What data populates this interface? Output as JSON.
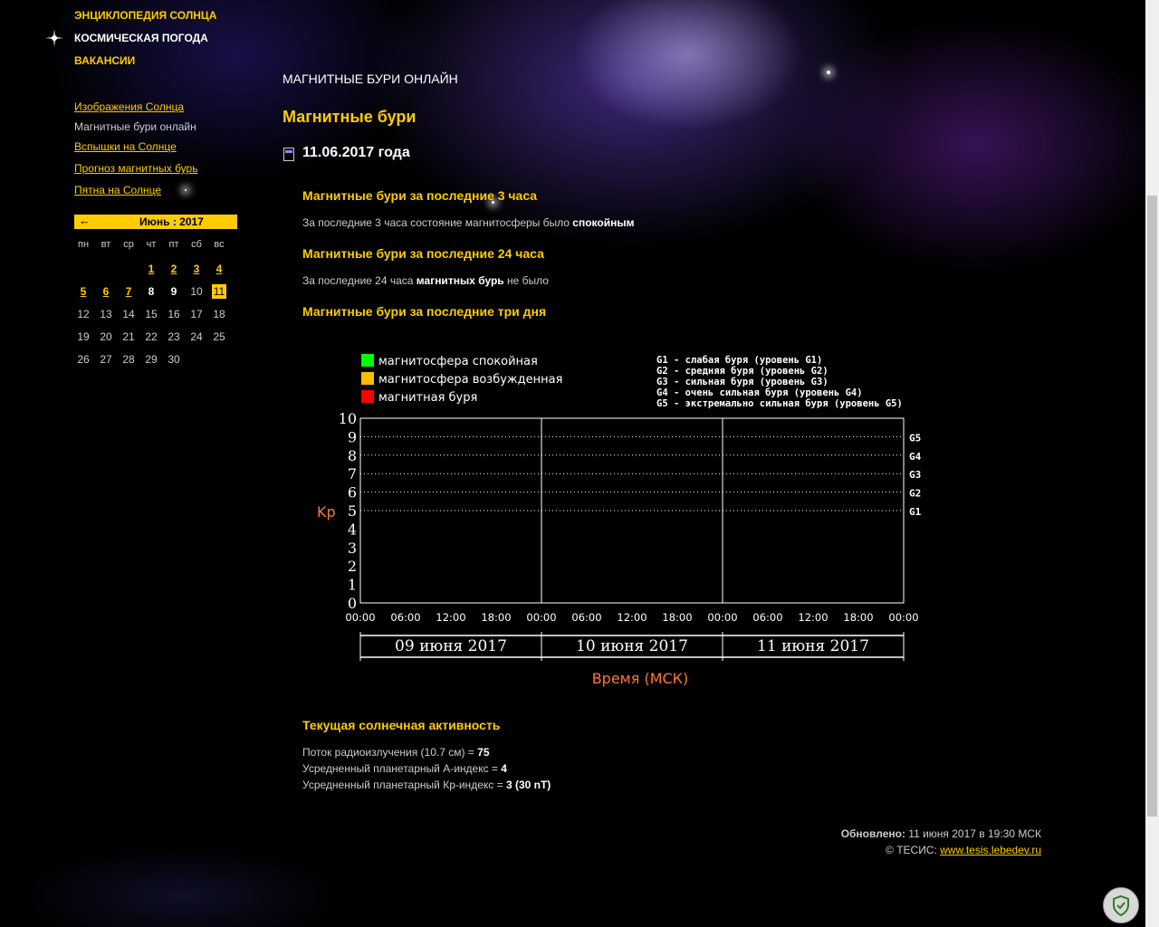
{
  "topnav": [
    {
      "label": "Энциклопедия Солнца"
    },
    {
      "label": "Космическая погода"
    },
    {
      "label": "Вакансии"
    }
  ],
  "subnav": [
    {
      "label": "Изображения Солнца"
    },
    {
      "label": "Магнитные бури онлайн"
    },
    {
      "label": "Вспышки на Солнце"
    },
    {
      "label": "Прогноз магнитных бурь"
    },
    {
      "label": "Пятна на Солнце"
    }
  ],
  "calendar": {
    "prev_arrow": "←",
    "title": "Июнь : 2017",
    "weekdays": [
      "пн",
      "вт",
      "ср",
      "чт",
      "пт",
      "сб",
      "вс"
    ],
    "rows": [
      [
        "",
        "",
        "",
        "1",
        "2",
        "3",
        "4"
      ],
      [
        "5",
        "6",
        "7",
        "8",
        "9",
        "10",
        "11"
      ],
      [
        "12",
        "13",
        "14",
        "15",
        "16",
        "17",
        "18"
      ],
      [
        "19",
        "20",
        "21",
        "22",
        "23",
        "24",
        "25"
      ],
      [
        "26",
        "27",
        "28",
        "29",
        "30",
        "",
        ""
      ]
    ],
    "linked": [
      "1",
      "2",
      "3",
      "4",
      "5",
      "6",
      "7"
    ],
    "bold": [
      "8",
      "9"
    ],
    "today": "11"
  },
  "page": {
    "section_title": "Магнитные бури онлайн",
    "title": "Магнитные бури",
    "date": "11.06.2017 года"
  },
  "block3h": {
    "heading": "Магнитные бури за последние 3 часа",
    "text": "За последние 3 часа состояние магнитосферы было ",
    "value": "спокойным"
  },
  "block24h": {
    "heading": "Магнитные бури за последние 24 часа",
    "text": "За последние 24 часа ",
    "value": "магнитных бурь",
    "text_end": " не было"
  },
  "block3d": {
    "heading": "Магнитные бури за последние три дня"
  },
  "chart_data": {
    "type": "bar",
    "ylabel": "Kp",
    "xlabel": "Время (МСК)",
    "ylim": [
      0,
      10
    ],
    "yticks": [
      "0",
      "1",
      "2",
      "3",
      "4",
      "5",
      "6",
      "7",
      "8",
      "9",
      "10"
    ],
    "xticks": [
      "00:00",
      "06:00",
      "12:00",
      "18:00",
      "00:00",
      "06:00",
      "12:00",
      "18:00",
      "00:00",
      "06:00",
      "12:00",
      "18:00",
      "00:00"
    ],
    "days": [
      "09 июня 2017",
      "10 июня 2017",
      "11 июня 2017"
    ],
    "values": [],
    "legend": [
      {
        "label": "магнитосфера спокойная",
        "color": "#00ff00"
      },
      {
        "label": "магнитосфера возбужденная",
        "color": "#ffbb00"
      },
      {
        "label": "магнитная буря",
        "color": "#ff0000"
      }
    ],
    "storm_levels": [
      {
        "label": "G1 - слабая буря (уровень G1)"
      },
      {
        "label": "G2 - средняя буря (уровень G2)"
      },
      {
        "label": "G3 - сильная буря (уровень G3)"
      },
      {
        "label": "G4 - очень сильная буря (уровень G4)"
      },
      {
        "label": "G5 - экстремально сильная буря (уровень G5)"
      }
    ],
    "g_lines": [
      {
        "label": "G1",
        "kp": 5
      },
      {
        "label": "G2",
        "kp": 6
      },
      {
        "label": "G3",
        "kp": 7
      },
      {
        "label": "G4",
        "kp": 8
      },
      {
        "label": "G5",
        "kp": 9
      }
    ],
    "grid": true
  },
  "solar": {
    "heading": "Текущая солнечная активность",
    "radio_label": "Поток радиоизлучения (10.7 см) = ",
    "radio_value": "75",
    "a_label": "Усредненный планетарный А-индекс = ",
    "a_value": "4",
    "kp_label": "Усредненный планетарный Кр-индекс = ",
    "kp_value": "3 (30 nT)"
  },
  "footer": {
    "updated_label": "Обновлено:",
    "updated_value": " 11 июня 2017 в 19:30 МСК",
    "copyright": "© ТЕСИС: ",
    "link": "www.tesis.lebedev.ru"
  }
}
